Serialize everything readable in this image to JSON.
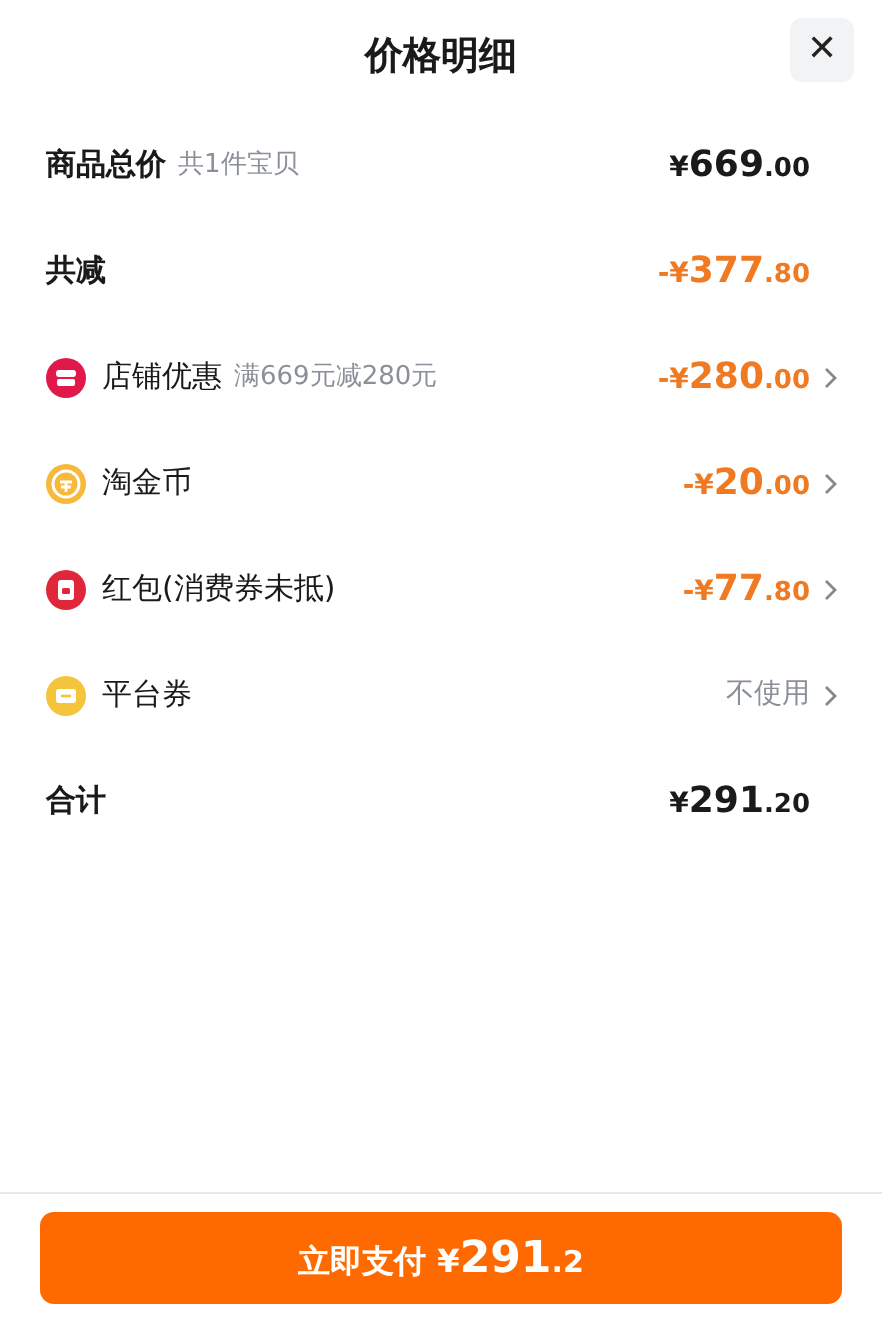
{
  "title": "价格明细",
  "close": "✕",
  "rows": [
    {
      "label": "商品总价",
      "note": "共1件宝贝",
      "amount": {
        "kind": "normal",
        "prefix": "¥",
        "main": "669",
        "decimals": ".00"
      },
      "chevron": false
    },
    {
      "label": "共减",
      "amount": {
        "kind": "discount",
        "prefix": "-¥",
        "main": "377",
        "decimals": ".80"
      },
      "chevron": false
    },
    {
      "label": "店铺优惠",
      "kind": "shop",
      "note": "满669元减280元",
      "amount": {
        "kind": "discount",
        "prefix": "-¥",
        "main": "280",
        "decimals": ".00"
      },
      "chevron": true
    },
    {
      "label": "淘金币",
      "kind": "coin",
      "amount": {
        "kind": "discount",
        "prefix": "-¥",
        "main": "20",
        "decimals": ".00"
      },
      "chevron": true
    },
    {
      "label": "红包(消费券未抵)",
      "kind": "envelope",
      "amount": {
        "kind": "discount",
        "prefix": "-¥",
        "main": "77",
        "decimals": ".80"
      },
      "chevron": true
    },
    {
      "label": "平台券",
      "kind": "coupon",
      "value": "不使用",
      "chevron": true
    },
    {
      "label": "合计",
      "amount": {
        "kind": "normal",
        "prefix": "¥",
        "main": "291",
        "decimals": ".20"
      },
      "chevron": false
    }
  ],
  "pay_button": {
    "label": "立即支付",
    "prefix": "¥",
    "main": "291",
    "decimals": ".2"
  }
}
